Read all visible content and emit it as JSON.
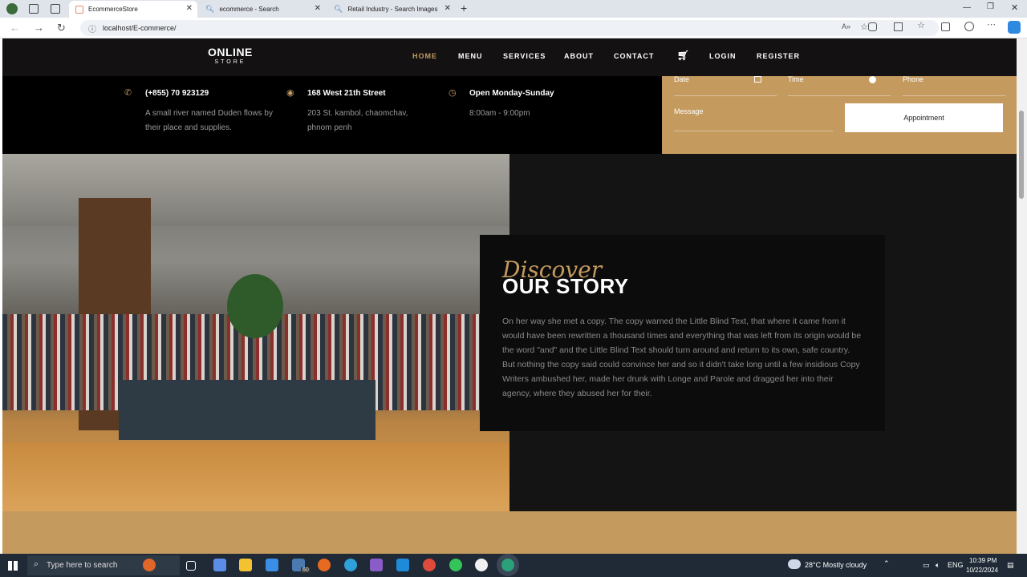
{
  "browser": {
    "tabs": [
      {
        "label": "EcommerceStore"
      },
      {
        "label": "ecommerce - Search"
      },
      {
        "label": "Retail Industry - Search Images"
      }
    ],
    "url": "localhost/E-commerce/"
  },
  "site": {
    "logo_line1": "ONLINE",
    "logo_line2": "STORE",
    "nav": [
      "HOME",
      "MENU",
      "SERVICES",
      "ABOUT",
      "CONTACT",
      "LOGIN",
      "REGISTER"
    ],
    "info": [
      {
        "title": "(+855) 70 923129",
        "text": "A small river named Duden flows by their place and supplies."
      },
      {
        "title": "168 West 21th Street",
        "text": "203 St. kambol, chaomchav, phnom penh"
      },
      {
        "title": "Open Monday-Sunday",
        "text": "8:00am - 9:00pm"
      }
    ],
    "form": {
      "date": "Date",
      "time": "Time",
      "phone": "Phone",
      "message": "Message",
      "button": "Appointment"
    },
    "story": {
      "discover": "Discover",
      "heading": "OUR STORY",
      "body": "On her way she met a copy. The copy warned the Little Blind Text, that where it came from it would have been rewritten a thousand times and everything that was left from its origin would be the word \"and\" and the Little Blind Text should turn around and return to its own, safe country. But nothing the copy said could convince her and so it didn't take long until a few insidious Copy Writers ambushed her, made her drunk with Longe and Parole and dragged her into their agency, where they abused her for their."
    }
  },
  "taskbar": {
    "search_placeholder": "Type here to search",
    "weather": "28°C  Mostly cloudy",
    "lang": "ENG",
    "time": "10:39 PM",
    "date": "10/22/2024",
    "badge": "60"
  },
  "colors": {
    "accent": "#c49a5e",
    "header": "#131111",
    "dark": "#151414"
  }
}
